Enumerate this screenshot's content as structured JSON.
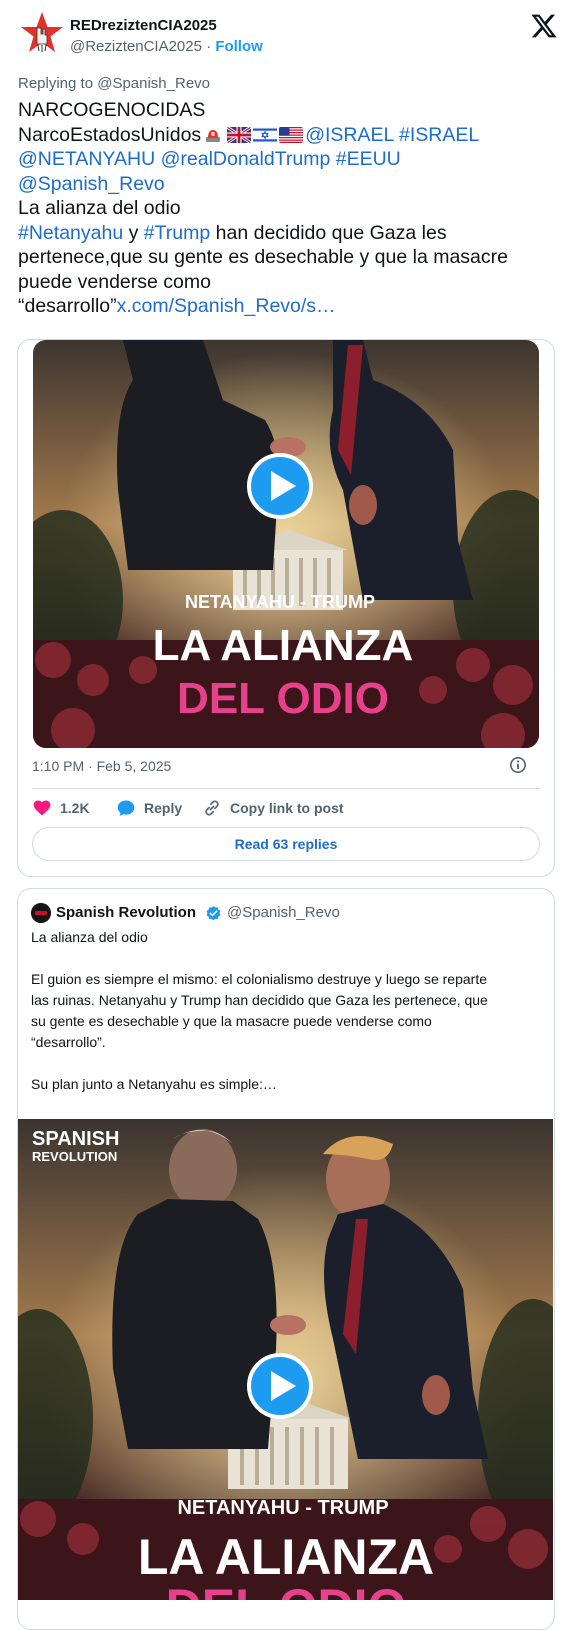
{
  "author": {
    "display_name": "REDreziztenCIA2025",
    "handle": "@ReziztenCIA2025",
    "separator": " · ",
    "follow_label": "Follow"
  },
  "reply_to": "Replying to @Spanish_Revo",
  "tweet": {
    "line1": "NARCOGENOCIDAS",
    "line2_text": "NarcoEstadosUnidos",
    "emojis": [
      "rotating-light",
      "flag-gb",
      "flag-il",
      "flag-us"
    ],
    "line2_links": "@ISRAEL #ISRAEL",
    "line3_links": "@NETANYAHU @realDonaldTrump #EEUU",
    "line4_link": "@Spanish_Revo",
    "line5": "La alianza del odio",
    "line6_hash1": "#Netanyahu",
    "line6_mid": " y ",
    "line6_hash2": "#Trump",
    "line6_rest": " han decidido que Gaza les",
    "line7": "pertenece,que su gente es desechable y que la masacre",
    "line8": "puede venderse como",
    "line9_text": "“desarrollo”",
    "line9_link": "x.com/Spanish_Revo/s…"
  },
  "media": {
    "subtitle": "NETANYAHU - TRUMP",
    "title_line1": "LA ALIANZA",
    "title_line2": "DEL ODIO",
    "watermark_line1": "SPANISH",
    "watermark_line2": "REVOLUTION"
  },
  "meta": {
    "time": "1:10 PM · Feb 5, 2025"
  },
  "actions": {
    "like_count": "1.2K",
    "reply_label": "Reply",
    "copy_label": "Copy link to post"
  },
  "read_replies": "Read 63 replies",
  "quoted": {
    "display_name": "Spanish Revolution",
    "handle": "@Spanish_Revo",
    "para1": "La alianza del odio",
    "para2_l1": "El guion es siempre el mismo: el colonialismo destruye y luego se reparte",
    "para2_l2": "las ruinas. Netanyahu y Trump han decidido que Gaza les pertenece, que",
    "para2_l3": "su gente es desechable y que la masacre puede venderse como",
    "para2_l4": "“desarrollo”.",
    "para3": "Su plan junto a Netanyahu es simple:…"
  },
  "colors": {
    "link": "#1d6ccf",
    "text": "#0f1419",
    "muted": "#536471",
    "like_pink": "#f91880",
    "title_pink": "#e8418c"
  }
}
